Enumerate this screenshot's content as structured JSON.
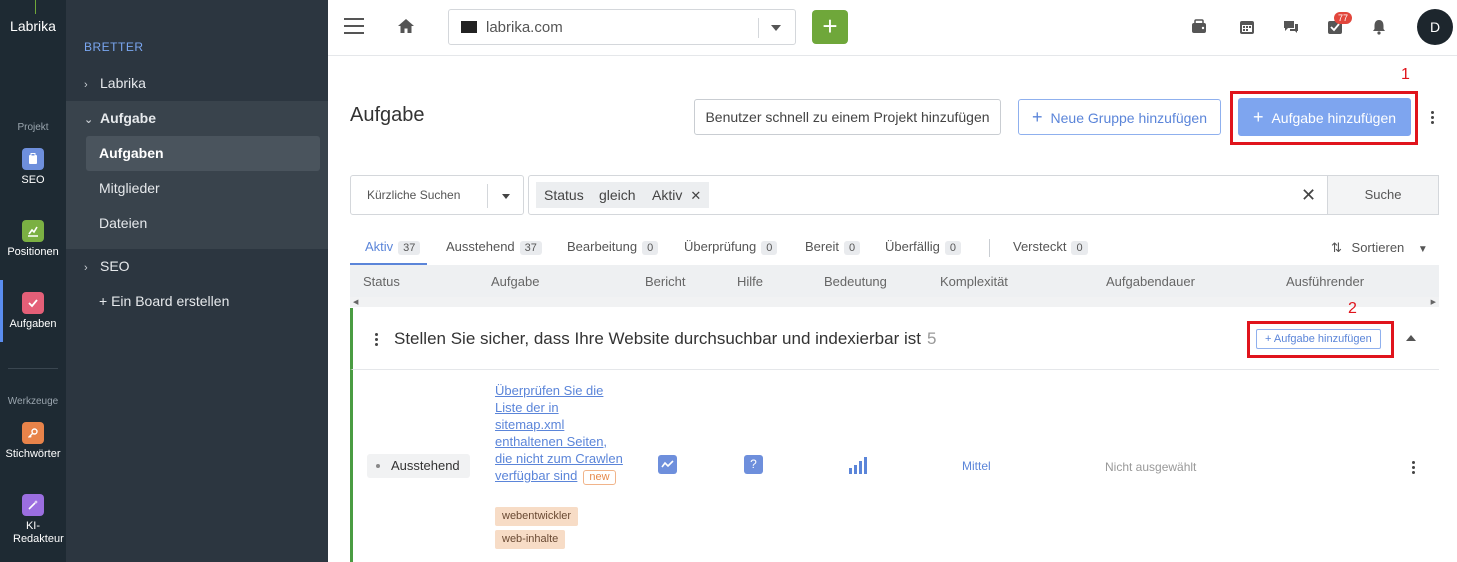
{
  "rail": {
    "logo": "Labrika",
    "section_project": "Projekt",
    "section_tools": "Werkzeuge",
    "items": [
      {
        "label": "SEO",
        "icon": "clipboard-icon",
        "color": "#6e8fdc"
      },
      {
        "label": "Positionen",
        "icon": "chart-icon",
        "color": "#7bb043"
      },
      {
        "label": "Aufgaben",
        "icon": "check-icon",
        "color": "#e45f78"
      },
      {
        "label": "Stichwörter",
        "icon": "key-icon",
        "color": "#e8834a"
      },
      {
        "label": "KI-Redakteur",
        "icon": "magic-wand-icon",
        "color": "#9b6ee0"
      }
    ]
  },
  "sidebar": {
    "header": "BRETTER",
    "items": [
      {
        "label": "Labrika",
        "chev": "›"
      },
      {
        "label": "Aufgabe",
        "chev": "⌄"
      },
      {
        "label": "Aufgaben"
      },
      {
        "label": "Mitglieder"
      },
      {
        "label": "Dateien"
      },
      {
        "label": "SEO",
        "chev": "›"
      },
      {
        "label": "+ Ein Board erstellen"
      }
    ]
  },
  "topbar": {
    "project": "labrika.com",
    "notification_count": "77",
    "avatar": "D"
  },
  "page": {
    "title": "Aufgabe",
    "btn_quick_add_user": "Benutzer schnell zu einem Projekt hinzufügen",
    "btn_new_group": "Neue Gruppe hinzufügen",
    "btn_add_task": "Aufgabe hinzufügen",
    "marker_1": "1",
    "marker_2": "2"
  },
  "filters": {
    "recent": "Kürzliche Suchen",
    "chips": [
      "Status",
      "gleich",
      "Aktiv"
    ],
    "search": "Suche"
  },
  "tabs": [
    {
      "label": "Aktiv",
      "count": "37"
    },
    {
      "label": "Ausstehend",
      "count": "37"
    },
    {
      "label": "Bearbeitung",
      "count": "0"
    },
    {
      "label": "Überprüfung",
      "count": "0"
    },
    {
      "label": "Bereit",
      "count": "0"
    },
    {
      "label": "Überfällig",
      "count": "0"
    },
    {
      "label": "Versteckt",
      "count": "0"
    }
  ],
  "sort_label": "Sortieren",
  "columns": [
    "Status",
    "Aufgabe",
    "Bericht",
    "Hilfe",
    "Bedeutung",
    "Komplexität",
    "Aufgabendauer",
    "Ausführender"
  ],
  "group": {
    "title": "Stellen Sie sicher, dass Ihre Website durchsuchbar und indexierbar ist",
    "count": "5",
    "add_label": "+ Aufgabe hinzufügen"
  },
  "row": {
    "status": "Ausstehend",
    "task": "Überprüfen Sie die Liste der in sitemap.xml enthaltenen Seiten, die nicht zum Crawlen verfügbar sind",
    "new_tag": "new",
    "tags": [
      "webentwickler",
      "web-inhalte"
    ],
    "help": "?",
    "complexity": "Mittel",
    "assignee": "Nicht ausgewählt"
  }
}
